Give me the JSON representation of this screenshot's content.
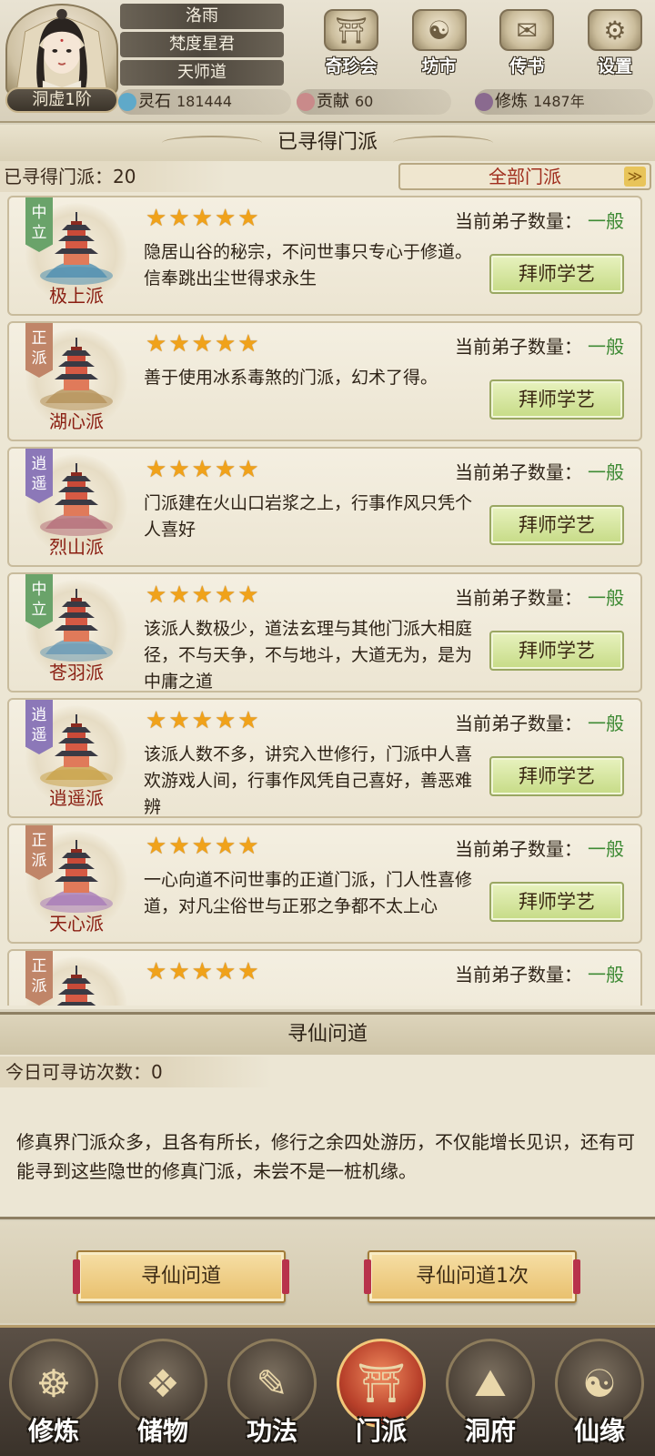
{
  "header": {
    "rank": "洞虚1阶",
    "name": "洛雨",
    "title": "梵度星君",
    "path": "天师道",
    "nav": [
      {
        "label": "奇珍会",
        "icon": "treasure-pavilion-icon"
      },
      {
        "label": "坊市",
        "icon": "market-icon"
      },
      {
        "label": "传书",
        "icon": "scroll-letter-icon"
      },
      {
        "label": "设置",
        "icon": "gear-icon"
      }
    ],
    "stats": [
      {
        "label": "灵石",
        "value": "181444",
        "icon": "spirit-stone-icon",
        "color": "#5fa9c9"
      },
      {
        "label": "贡献",
        "value": "60",
        "icon": "contribution-icon",
        "color": "#c98a8a"
      },
      {
        "label": "修炼",
        "value": "1487年",
        "icon": "cultivation-icon",
        "color": "#8a6a8f"
      }
    ]
  },
  "sects_section": {
    "title": "已寻得门派",
    "found_label": "已寻得门派：20",
    "filter_value": "全部门派"
  },
  "sects": [
    {
      "name": "极上派",
      "tag": "中立",
      "tag_type": "neutral",
      "stars": 5,
      "disciples_label": "当前弟子数量：",
      "disciples_value": "一般",
      "desc": "隐居山谷的秘宗，不问世事只专心于修道。信奉跳出尘世得求永生",
      "button": "拜师学艺",
      "palette": "#4f8fb0"
    },
    {
      "name": "湖心派",
      "tag": "正派",
      "tag_type": "righteous",
      "stars": 5,
      "disciples_label": "当前弟子数量：",
      "disciples_value": "一般",
      "desc": "善于使用冰系毒煞的门派，幻术了得。",
      "button": "拜师学艺",
      "palette": "#b5925a"
    },
    {
      "name": "烈山派",
      "tag": "逍遥",
      "tag_type": "free",
      "stars": 5,
      "disciples_label": "当前弟子数量：",
      "disciples_value": "一般",
      "desc": "门派建在火山口岩浆之上，行事作风只凭个人喜好",
      "button": "拜师学艺",
      "palette": "#b56f7a"
    },
    {
      "name": "苍羽派",
      "tag": "中立",
      "tag_type": "neutral",
      "stars": 5,
      "disciples_label": "当前弟子数量：",
      "disciples_value": "一般",
      "desc": "该派人数极少，道法玄理与其他门派大相庭径，不与天争，不与地斗，大道无为，是为中庸之道",
      "button": "拜师学艺",
      "palette": "#6a9ab5"
    },
    {
      "name": "逍遥派",
      "tag": "逍遥",
      "tag_type": "free",
      "stars": 5,
      "disciples_label": "当前弟子数量：",
      "disciples_value": "一般",
      "desc": "该派人数不多，讲究入世修行，门派中人喜欢游戏人间，行事作风凭自己喜好，善恶难辨",
      "button": "拜师学艺",
      "palette": "#c9a24a"
    },
    {
      "name": "天心派",
      "tag": "正派",
      "tag_type": "righteous",
      "stars": 5,
      "disciples_label": "当前弟子数量：",
      "disciples_value": "一般",
      "desc": "一心向道不问世事的正道门派，门人性喜修道，对凡尘俗世与正邪之争都不太上心",
      "button": "拜师学艺",
      "palette": "#a87cb8"
    },
    {
      "name": "",
      "tag": "正派",
      "tag_type": "righteous",
      "stars": 5,
      "disciples_label": "当前弟子数量：",
      "disciples_value": "一般",
      "desc": "",
      "button": "",
      "palette": "#5a8a6a"
    }
  ],
  "seek_section": {
    "title": "寻仙问道",
    "visits_label": "今日可寻访次数：0",
    "desc": "修真界门派众多，且各有所长，修行之余四处游历，不仅能增长见识，还有可能寻到这些隐世的修真门派，未尝不是一桩机缘。",
    "btn_seek": "寻仙问道",
    "btn_seek_once": "寻仙问道1次"
  },
  "bottom_nav": [
    {
      "label": "修炼",
      "icon": "meditation-icon",
      "active": false
    },
    {
      "label": "储物",
      "icon": "storage-bag-icon",
      "active": false
    },
    {
      "label": "功法",
      "icon": "technique-scroll-icon",
      "active": false
    },
    {
      "label": "门派",
      "icon": "sect-gate-icon",
      "active": true
    },
    {
      "label": "洞府",
      "icon": "cave-mansion-icon",
      "active": false
    },
    {
      "label": "仙缘",
      "icon": "immortal-fate-icon",
      "active": false
    }
  ]
}
